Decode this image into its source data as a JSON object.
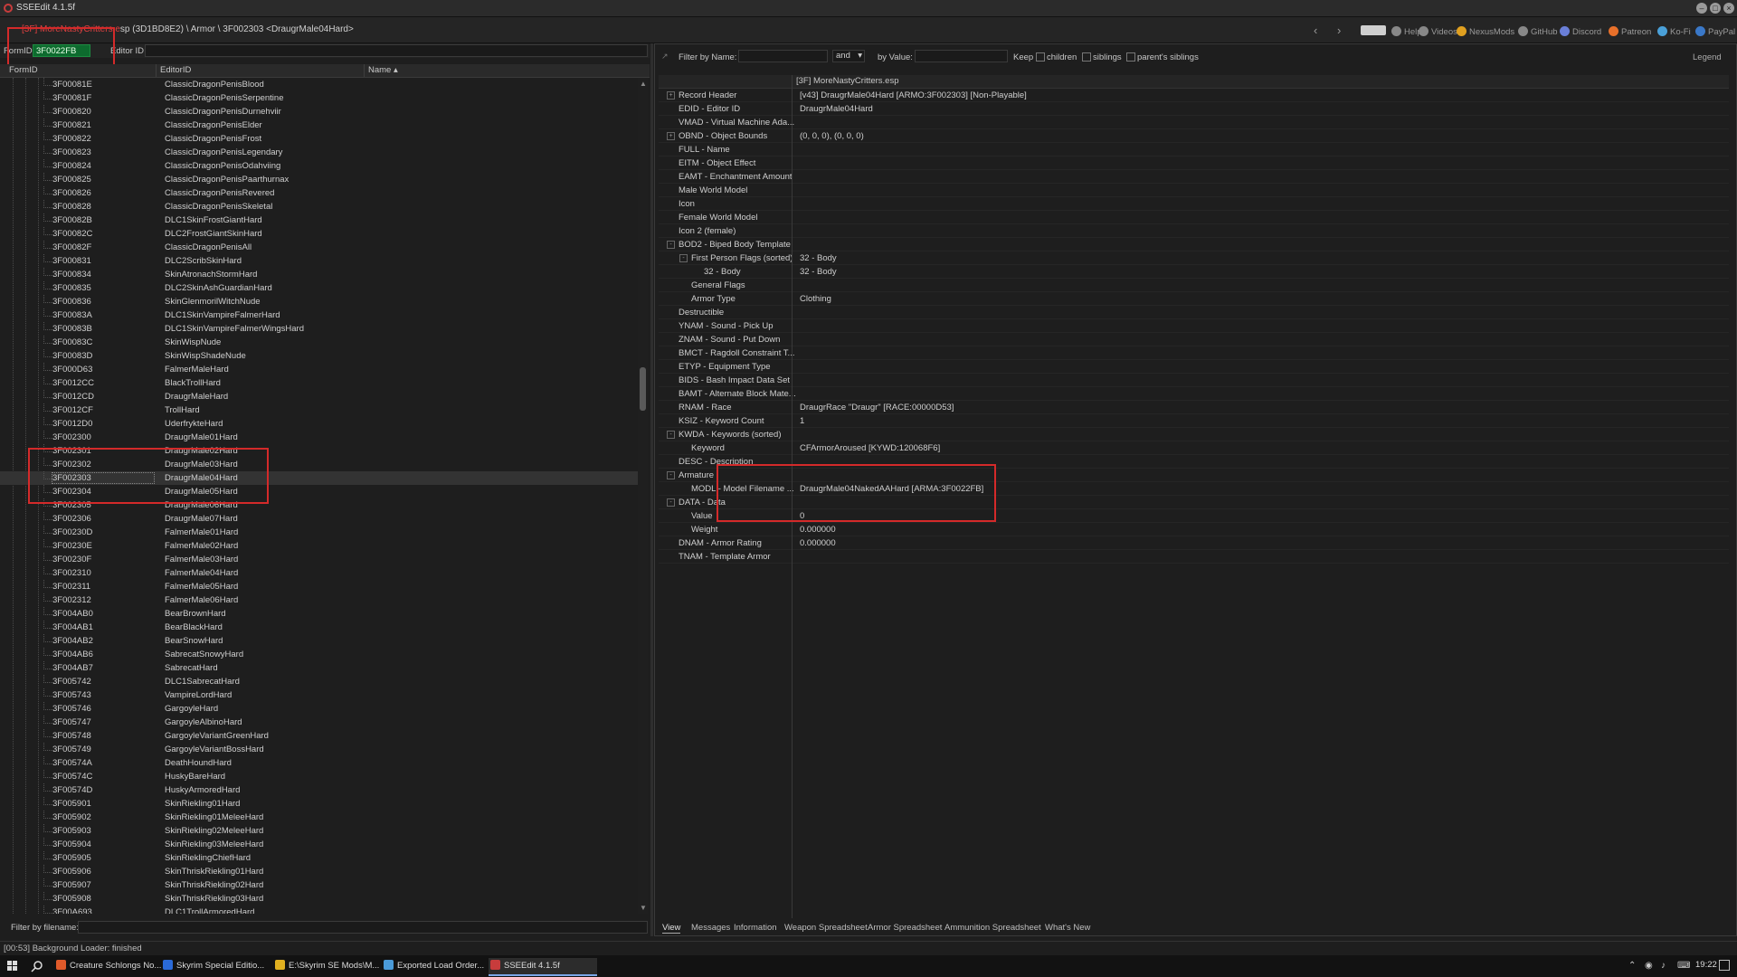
{
  "window": {
    "title": "SSEEdit 4.1.5f",
    "controls": [
      "minimize",
      "maximize",
      "close"
    ]
  },
  "path": {
    "plugin_red": "[3F] MoreNastyCritters.e",
    "rest": "sp (3D1BD8E2) \\ Armor \\ 3F002303 <DraugrMale04Hard>"
  },
  "nav": {
    "back_icon": "arrow-left",
    "forward_icon": "arrow-right"
  },
  "top_links": [
    {
      "label": "Help",
      "color": "#888888"
    },
    {
      "label": "Videos",
      "color": "#888888"
    },
    {
      "label": "NexusMods",
      "color": "#e0a020"
    },
    {
      "label": "GitHub",
      "color": "#888888"
    },
    {
      "label": "Discord",
      "color": "#6a7fd8"
    },
    {
      "label": "Patreon",
      "color": "#e8702a"
    },
    {
      "label": "Ko-Fi",
      "color": "#4aa0d8"
    },
    {
      "label": "PayPal",
      "color": "#3a78c8"
    }
  ],
  "left_filter": {
    "formid_label": "FormID",
    "formid_value": "3F0022FB",
    "editorid_label": "Editor ID",
    "editorid_value": ""
  },
  "left_columns": [
    "FormID",
    "EditorID",
    "Name"
  ],
  "left_rows": [
    {
      "fid": "3F00081E",
      "eid": "ClassicDragonPenisBlood"
    },
    {
      "fid": "3F00081F",
      "eid": "ClassicDragonPenisSerpentine"
    },
    {
      "fid": "3F000820",
      "eid": "ClassicDragonPenisDurnehviir"
    },
    {
      "fid": "3F000821",
      "eid": "ClassicDragonPenisElder"
    },
    {
      "fid": "3F000822",
      "eid": "ClassicDragonPenisFrost"
    },
    {
      "fid": "3F000823",
      "eid": "ClassicDragonPenisLegendary"
    },
    {
      "fid": "3F000824",
      "eid": "ClassicDragonPenisOdahviing"
    },
    {
      "fid": "3F000825",
      "eid": "ClassicDragonPenisPaarthurnax"
    },
    {
      "fid": "3F000826",
      "eid": "ClassicDragonPenisRevered"
    },
    {
      "fid": "3F000828",
      "eid": "ClassicDragonPenisSkeletal"
    },
    {
      "fid": "3F00082B",
      "eid": "DLC1SkinFrostGiantHard"
    },
    {
      "fid": "3F00082C",
      "eid": "DLC2FrostGiantSkinHard"
    },
    {
      "fid": "3F00082F",
      "eid": "ClassicDragonPenisAll"
    },
    {
      "fid": "3F000831",
      "eid": "DLC2ScribSkinHard"
    },
    {
      "fid": "3F000834",
      "eid": "SkinAtronachStormHard"
    },
    {
      "fid": "3F000835",
      "eid": "DLC2SkinAshGuardianHard"
    },
    {
      "fid": "3F000836",
      "eid": "SkinGlenmorilWitchNude"
    },
    {
      "fid": "3F00083A",
      "eid": "DLC1SkinVampireFalmerHard"
    },
    {
      "fid": "3F00083B",
      "eid": "DLC1SkinVampireFalmerWingsHard"
    },
    {
      "fid": "3F00083C",
      "eid": "SkinWispNude"
    },
    {
      "fid": "3F00083D",
      "eid": "SkinWispShadeNude"
    },
    {
      "fid": "3F000D63",
      "eid": "FalmerMaleHard"
    },
    {
      "fid": "3F0012CC",
      "eid": "BlackTrollHard"
    },
    {
      "fid": "3F0012CD",
      "eid": "DraugrMaleHard"
    },
    {
      "fid": "3F0012CF",
      "eid": "TrollHard"
    },
    {
      "fid": "3F0012D0",
      "eid": "UderfrykteHard"
    },
    {
      "fid": "3F002300",
      "eid": "DraugrMale01Hard"
    },
    {
      "fid": "3F002301",
      "eid": "DraugrMale02Hard"
    },
    {
      "fid": "3F002302",
      "eid": "DraugrMale03Hard"
    },
    {
      "fid": "3F002303",
      "eid": "DraugrMale04Hard",
      "selected": true
    },
    {
      "fid": "3F002304",
      "eid": "DraugrMale05Hard"
    },
    {
      "fid": "3F002305",
      "eid": "DraugrMale06Hard"
    },
    {
      "fid": "3F002306",
      "eid": "DraugrMale07Hard"
    },
    {
      "fid": "3F00230D",
      "eid": "FalmerMale01Hard"
    },
    {
      "fid": "3F00230E",
      "eid": "FalmerMale02Hard"
    },
    {
      "fid": "3F00230F",
      "eid": "FalmerMale03Hard"
    },
    {
      "fid": "3F002310",
      "eid": "FalmerMale04Hard"
    },
    {
      "fid": "3F002311",
      "eid": "FalmerMale05Hard"
    },
    {
      "fid": "3F002312",
      "eid": "FalmerMale06Hard"
    },
    {
      "fid": "3F004AB0",
      "eid": "BearBrownHard"
    },
    {
      "fid": "3F004AB1",
      "eid": "BearBlackHard"
    },
    {
      "fid": "3F004AB2",
      "eid": "BearSnowHard"
    },
    {
      "fid": "3F004AB6",
      "eid": "SabrecatSnowyHard"
    },
    {
      "fid": "3F004AB7",
      "eid": "SabrecatHard"
    },
    {
      "fid": "3F005742",
      "eid": "DLC1SabrecatHard"
    },
    {
      "fid": "3F005743",
      "eid": "VampireLordHard"
    },
    {
      "fid": "3F005746",
      "eid": "GargoyleHard"
    },
    {
      "fid": "3F005747",
      "eid": "GargoyleAlbinoHard"
    },
    {
      "fid": "3F005748",
      "eid": "GargoyleVariantGreenHard"
    },
    {
      "fid": "3F005749",
      "eid": "GargoyleVariantBossHard"
    },
    {
      "fid": "3F00574A",
      "eid": "DeathHoundHard"
    },
    {
      "fid": "3F00574C",
      "eid": "HuskyBareHard"
    },
    {
      "fid": "3F00574D",
      "eid": "HuskyArmoredHard"
    },
    {
      "fid": "3F005901",
      "eid": "SkinRiekling01Hard"
    },
    {
      "fid": "3F005902",
      "eid": "SkinRiekling01MeleeHard"
    },
    {
      "fid": "3F005903",
      "eid": "SkinRiekling02MeleeHard"
    },
    {
      "fid": "3F005904",
      "eid": "SkinRiekling03MeleeHard"
    },
    {
      "fid": "3F005905",
      "eid": "SkinRieklingChiefHard"
    },
    {
      "fid": "3F005906",
      "eid": "SkinThriskRiekling01Hard"
    },
    {
      "fid": "3F005907",
      "eid": "SkinThriskRiekling02Hard"
    },
    {
      "fid": "3F005908",
      "eid": "SkinThriskRiekling03Hard"
    },
    {
      "fid": "3F00A693",
      "eid": "DLC1TrollArmoredHard"
    }
  ],
  "left_bottom": {
    "label": "Filter by filename:",
    "value": ""
  },
  "right_filter": {
    "by_name_label": "Filter by Name:",
    "name_value": "",
    "operator": "and",
    "by_value_label": "by Value:",
    "value_value": "",
    "keep_label": "Keep",
    "options": [
      "children",
      "siblings",
      "parent's siblings"
    ],
    "legend_label": "Legend"
  },
  "right_file_header": "[3F] MoreNastyCritters.esp",
  "record_rows": [
    {
      "key": "Record Header",
      "value": "[v43] DraugrMale04Hard [ARMO:3F002303] [Non-Playable]",
      "level": 0,
      "expand": "+"
    },
    {
      "key": "EDID - Editor ID",
      "value": "DraugrMale04Hard",
      "level": 0
    },
    {
      "key": "VMAD - Virtual Machine Ada...",
      "value": "",
      "level": 0
    },
    {
      "key": "OBND - Object Bounds",
      "value": "(0, 0, 0), (0, 0, 0)",
      "level": 0,
      "expand": "+"
    },
    {
      "key": "FULL - Name",
      "value": "",
      "level": 0
    },
    {
      "key": "EITM - Object Effect",
      "value": "",
      "level": 0
    },
    {
      "key": "EAMT - Enchantment Amount",
      "value": "",
      "level": 0
    },
    {
      "key": "Male World Model",
      "value": "",
      "level": 0
    },
    {
      "key": "Icon",
      "value": "",
      "level": 0
    },
    {
      "key": "Female World Model",
      "value": "",
      "level": 0
    },
    {
      "key": "Icon 2 (female)",
      "value": "",
      "level": 0
    },
    {
      "key": "BOD2 - Biped Body Template",
      "value": "",
      "level": 0,
      "expand": "-"
    },
    {
      "key": "First Person Flags (sorted)",
      "value": "32 - Body",
      "level": 1,
      "expand": "-"
    },
    {
      "key": "32 - Body",
      "value": "32 - Body",
      "level": 2
    },
    {
      "key": "General Flags",
      "value": "",
      "level": 1
    },
    {
      "key": "Armor Type",
      "value": "Clothing",
      "level": 1
    },
    {
      "key": "Destructible",
      "value": "",
      "level": 0
    },
    {
      "key": "YNAM - Sound - Pick Up",
      "value": "",
      "level": 0
    },
    {
      "key": "ZNAM - Sound - Put Down",
      "value": "",
      "level": 0
    },
    {
      "key": "BMCT - Ragdoll Constraint T...",
      "value": "",
      "level": 0
    },
    {
      "key": "ETYP - Equipment Type",
      "value": "",
      "level": 0
    },
    {
      "key": "BIDS - Bash Impact Data Set",
      "value": "",
      "level": 0
    },
    {
      "key": "BAMT - Alternate Block Mate...",
      "value": "",
      "level": 0
    },
    {
      "key": "RNAM - Race",
      "value": "DraugrRace \"Draugr\" [RACE:00000D53]",
      "level": 0
    },
    {
      "key": "KSIZ - Keyword Count",
      "value": "1",
      "level": 0
    },
    {
      "key": "KWDA - Keywords (sorted)",
      "value": "",
      "level": 0,
      "expand": "-"
    },
    {
      "key": "Keyword",
      "value": "CFArmorAroused [KYWD:120068F6]",
      "level": 1
    },
    {
      "key": "DESC - Description",
      "value": "",
      "level": 0
    },
    {
      "key": "Armature",
      "value": "",
      "level": 0,
      "expand": "-"
    },
    {
      "key": "MODL - Model Filename ...",
      "value": "DraugrMale04NakedAAHard [ARMA:3F0022FB]",
      "level": 1
    },
    {
      "key": "DATA - Data",
      "value": "",
      "level": 0,
      "expand": "-"
    },
    {
      "key": "Value",
      "value": "0",
      "level": 1
    },
    {
      "key": "Weight",
      "value": "0.000000",
      "level": 1
    },
    {
      "key": "DNAM - Armor Rating",
      "value": "0.000000",
      "level": 0
    },
    {
      "key": "TNAM - Template Armor",
      "value": "",
      "level": 0
    }
  ],
  "right_tabs": [
    "View",
    "Messages",
    "Information",
    "Weapon Spreadsheet",
    "Armor Spreadsheet",
    "Ammunition Spreadsheet",
    "What's New"
  ],
  "active_tab": "View",
  "status": "[00:53] Background Loader: finished",
  "taskbar": {
    "items": [
      {
        "label": "Creature Schlongs No...",
        "color": "#e05a2a"
      },
      {
        "label": "Skyrim Special Editio...",
        "color": "#2a6ad8"
      },
      {
        "label": "E:\\Skyrim SE Mods\\M...",
        "color": "#e0b020"
      },
      {
        "label": "Exported Load Order...",
        "color": "#4a9ad8"
      },
      {
        "label": "SSEEdit 4.1.5f",
        "color": "#c83c3c",
        "active": true
      }
    ],
    "clock": "19:22"
  },
  "accent": {
    "highlight_red": "#d42a2a",
    "formid_green": "#0d6b2e"
  }
}
